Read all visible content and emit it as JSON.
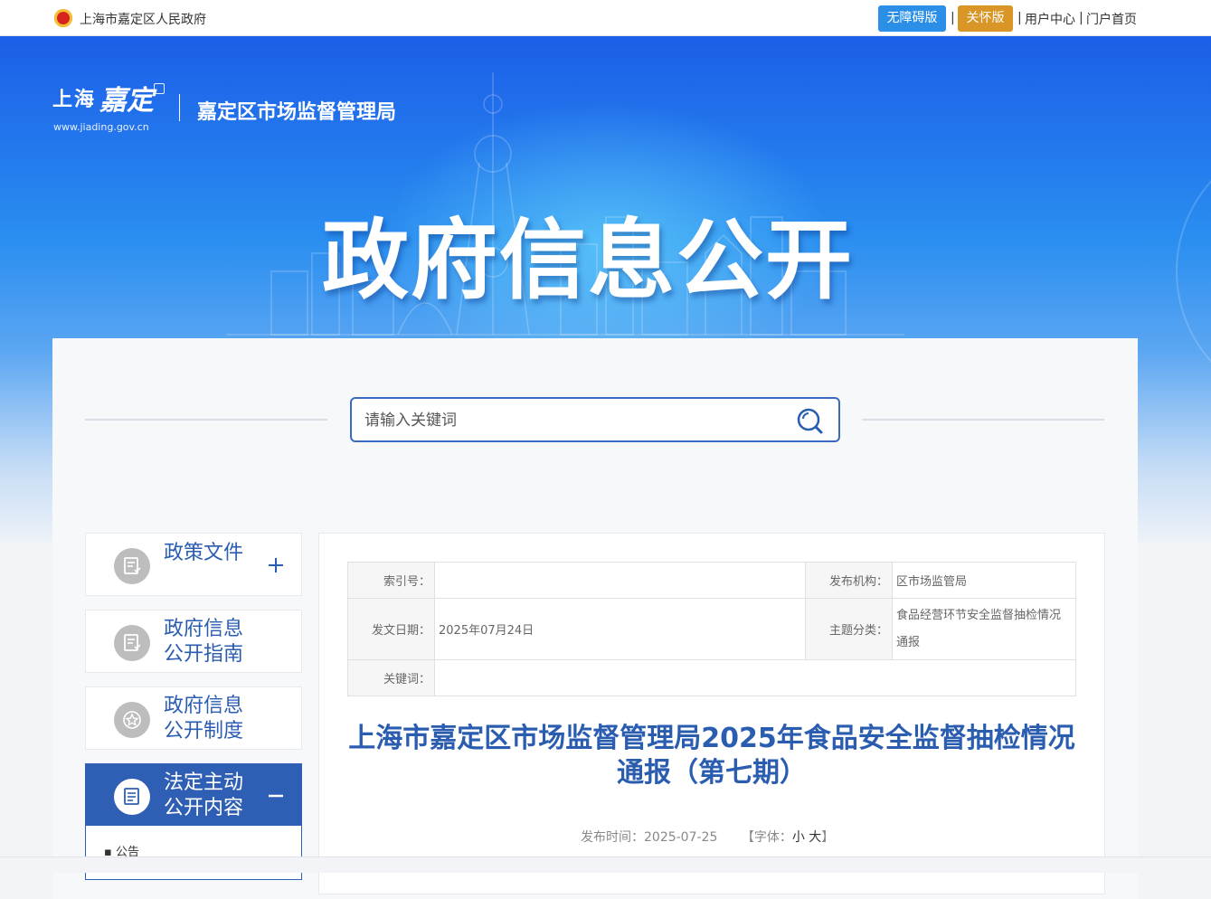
{
  "topbar": {
    "gov_name": "上海市嘉定区人民政府",
    "accessibility_label": "无障碍版",
    "care_label": "关怀版",
    "separator": "|",
    "user_center": "用户中心",
    "portal_home": "门户首页"
  },
  "banner": {
    "logo_text_1": "上海",
    "logo_text_2": "嘉定",
    "logo_url": "www.jiading.gov.cn",
    "bureau_name": "嘉定区市场监督管理局",
    "hero_title": "政府信息公开"
  },
  "search": {
    "placeholder": "请输入关键词"
  },
  "sidebar": {
    "items": [
      {
        "label": "政策文件",
        "toggle": "+"
      },
      {
        "label_1": "政府信息",
        "label_2": "公开指南"
      },
      {
        "label_1": "政府信息",
        "label_2": "公开制度"
      },
      {
        "label_1": "法定主动",
        "label_2": "公开内容",
        "toggle": "−"
      }
    ],
    "sub_items": [
      "公告"
    ]
  },
  "meta": {
    "index_label": "索引号：",
    "index_value": "",
    "publisher_label": "发布机构：",
    "publisher_value": "区市场监管局",
    "date_label": "发文日期：",
    "date_value": "2025年07月24日",
    "topic_label": "主题分类：",
    "topic_value": "食品经营环节安全监督抽检情况通报",
    "keyword_label": "关键词：",
    "keyword_value": ""
  },
  "article": {
    "title": "上海市嘉定区市场监督管理局2025年食品安全监督抽检情况通报（第七期）",
    "publish_label": "发布时间：",
    "publish_time": "2025-07-25",
    "font_label_open": "【字体：",
    "font_small": "小",
    "font_large": "大",
    "font_label_close": "】"
  },
  "colors": {
    "primary": "#2a5db0",
    "accessibility_btn": "#2b8fe8",
    "care_btn": "#d99626",
    "active_nav": "#2f5fb5"
  }
}
